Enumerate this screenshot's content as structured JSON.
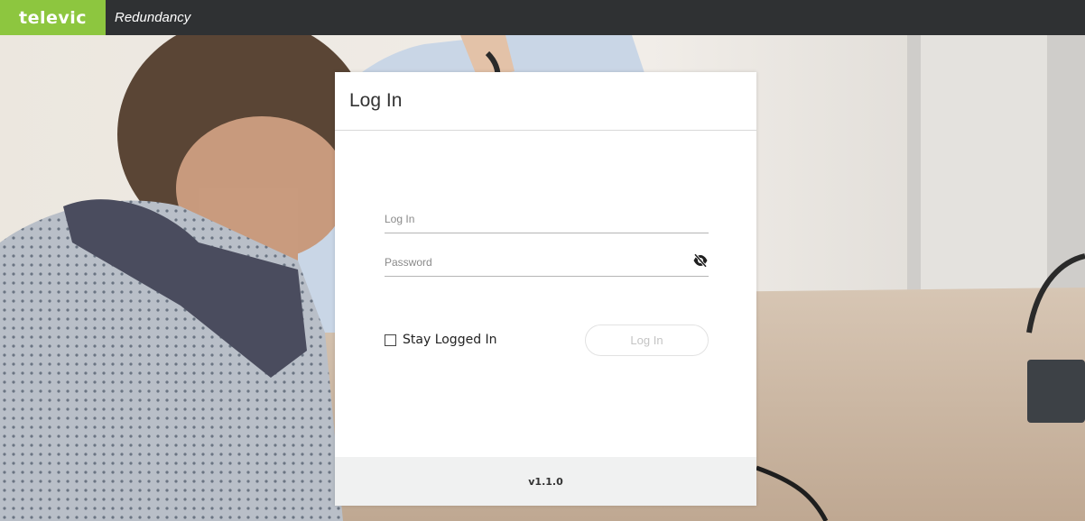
{
  "header": {
    "brand": "televic",
    "app_title": "Redundancy",
    "brand_color": "#8dc63f",
    "bar_color": "#2f3133"
  },
  "dialog": {
    "title": "Log In",
    "login_field": {
      "placeholder": "Log In",
      "value": ""
    },
    "password_field": {
      "placeholder": "Password",
      "value": "",
      "toggle_icon": "eye-slash-icon"
    },
    "stay_logged_in": {
      "label": "Stay Logged In",
      "checked": false
    },
    "login_button": "Log In",
    "version": "v1.1.0"
  }
}
